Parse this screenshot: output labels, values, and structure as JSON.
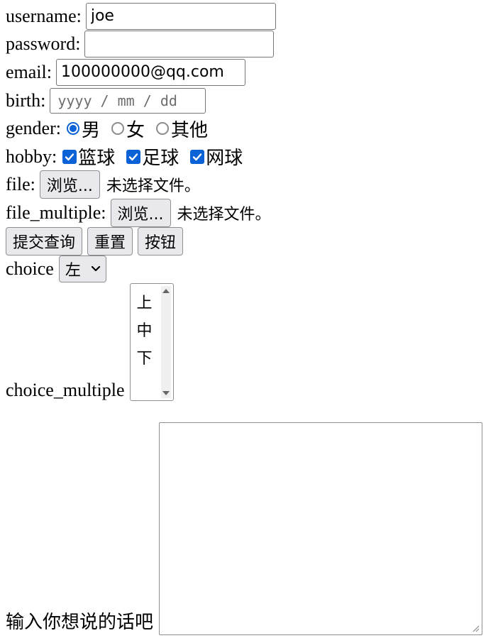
{
  "form": {
    "username": {
      "label": "username:",
      "value": "joe"
    },
    "password": {
      "label": "password:",
      "value": ""
    },
    "email": {
      "label": "email:",
      "value": "100000000@qq.com"
    },
    "birth": {
      "label": "birth:",
      "placeholder": "yyyy / mm / dd"
    },
    "gender": {
      "label": "gender:",
      "options": [
        "男",
        "女",
        "其他"
      ],
      "selected": "男"
    },
    "hobby": {
      "label": "hobby:",
      "options": [
        "篮球",
        "足球",
        "网球"
      ],
      "checked": [
        "篮球",
        "足球",
        "网球"
      ]
    },
    "file": {
      "label": "file:",
      "button": "浏览...",
      "status": "未选择文件。"
    },
    "file_multiple": {
      "label": "file_multiple:",
      "button": "浏览...",
      "status": "未选择文件。"
    },
    "buttons": {
      "submit": "提交查询",
      "reset": "重置",
      "button": "按钮"
    },
    "choice": {
      "label": "choice",
      "selected": "左"
    },
    "choice_multiple": {
      "label": "choice_multiple",
      "options": [
        "上",
        "中",
        "下"
      ]
    },
    "message": {
      "label": "输入你想说的话吧",
      "value": ""
    }
  },
  "colors": {
    "accent": "#0b62d6",
    "button_bg": "#e9e9ed",
    "border": "#8f8f8f"
  }
}
